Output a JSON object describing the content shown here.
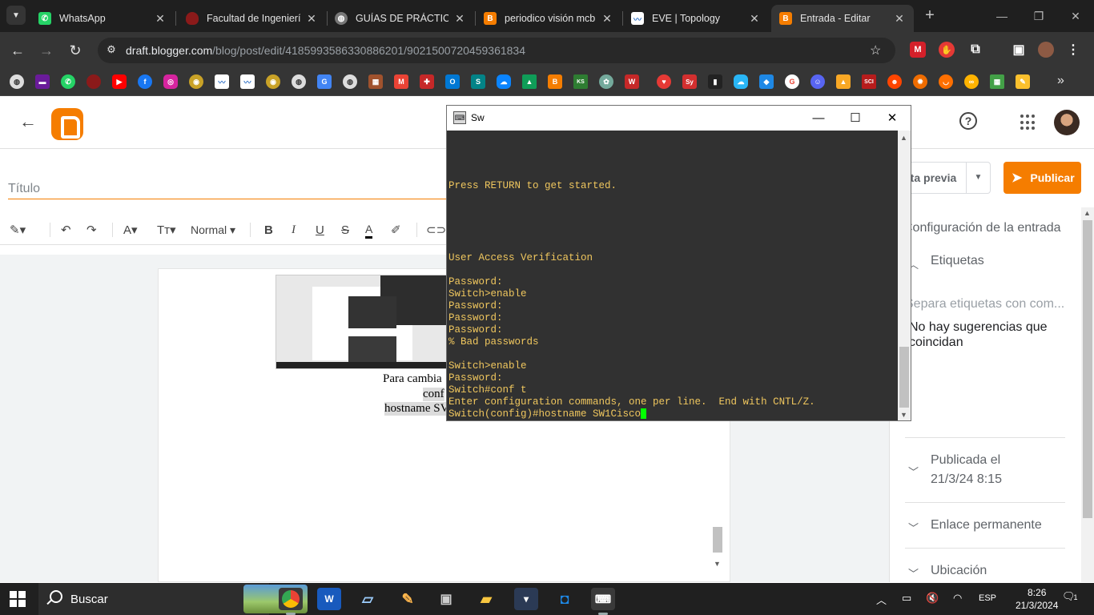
{
  "tabs": [
    {
      "title": "WhatsApp",
      "favicon": "whatsapp-icon",
      "color": "#25d366"
    },
    {
      "title": "Facultad de Ingeniería",
      "favicon": "university-icon",
      "color": "#8b1a1a"
    },
    {
      "title": "GUÍAS DE PRÁCTICAS",
      "favicon": "globe-icon",
      "color": "#888888"
    },
    {
      "title": "periodico visión mcb",
      "favicon": "blogger-icon",
      "color": "#f57d00"
    },
    {
      "title": "EVE | Topology",
      "favicon": "eve-icon",
      "color": "#3a78c9"
    },
    {
      "title": "Entrada - Editar",
      "favicon": "blogger-icon",
      "color": "#f57d00",
      "active": true
    }
  ],
  "address_bar": {
    "host": "draft.blogger.com",
    "path": "/blog/post/edit/4185993586330886201/9021500720459361834"
  },
  "blogger": {
    "title_placeholder": "Título",
    "format": {
      "paragraph_style": "Normal"
    },
    "doc_lines": [
      "Para cambia",
      "conf",
      "hostname SV"
    ],
    "preview_label": "ista previa",
    "publish_label": "Publicar",
    "panel": {
      "settings_heading": "Configuración de la entrada",
      "labels_heading": "Etiquetas",
      "labels_placeholder": "Separa etiquetas con com...",
      "no_suggestions": "No hay sugerencias que coincidan",
      "published_label": "Publicada el",
      "published_date": "21/3/24 8:15",
      "permalink": "Enlace permanente",
      "location": "Ubicación"
    }
  },
  "putty": {
    "title": "Sw",
    "lines": [
      "Press RETURN to get started.",
      "",
      "",
      "",
      "",
      "",
      "User Access Verification",
      "",
      "Password:",
      "Switch>enable",
      "Password:",
      "Password:",
      "Password:",
      "% Bad passwords",
      "",
      "Switch>enable",
      "Password:",
      "Switch#conf t",
      "Enter configuration commands, one per line.  End with CNTL/Z."
    ],
    "prompt_line": "Switch(config)#hostname SW1Cisco"
  },
  "taskbar": {
    "search_placeholder": "Buscar",
    "language": "ESP",
    "time": "8:26",
    "date": "21/3/2024",
    "notifications": "1"
  }
}
